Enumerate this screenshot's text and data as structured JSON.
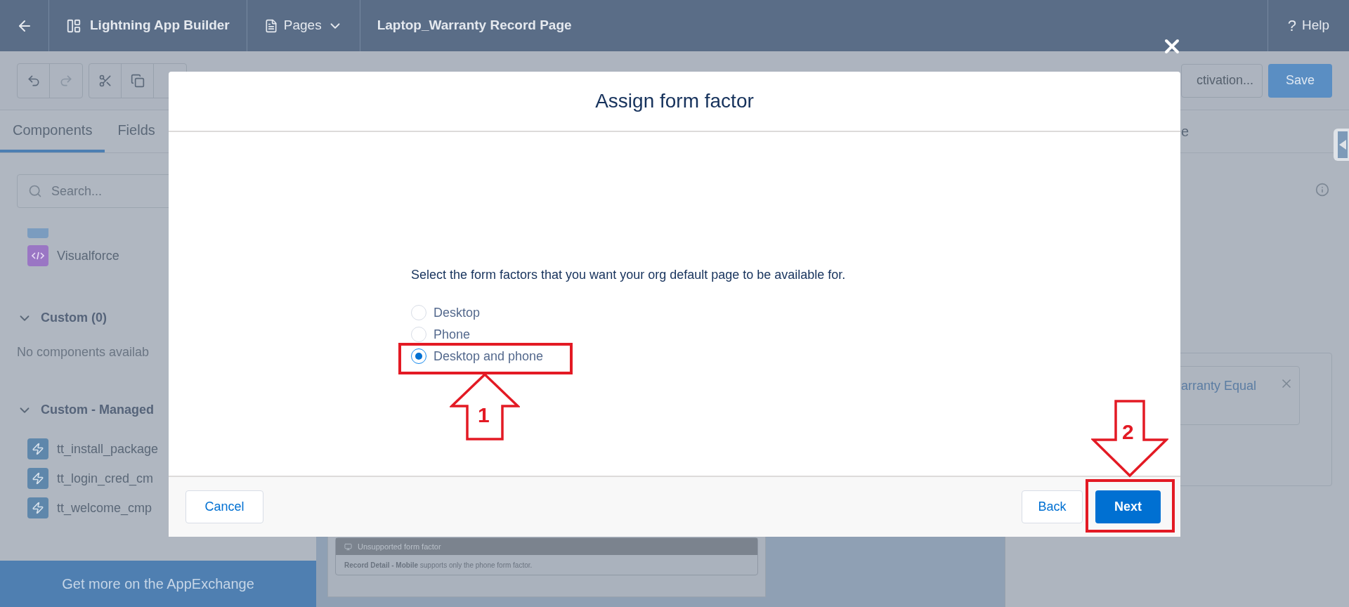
{
  "header": {
    "title": "Lightning App Builder",
    "pages_menu": "Pages",
    "page_name": "Laptop_Warranty Record Page",
    "help_icon": "?",
    "help": "Help"
  },
  "toolbar": {
    "activation_button": "ctivation...",
    "save_button": "Save"
  },
  "left_panel": {
    "tabs": [
      {
        "label": "Components",
        "selected": true
      },
      {
        "label": "Fields",
        "selected": false
      }
    ],
    "search": {
      "placeholder": "Search..."
    },
    "top_items": [
      {
        "kind": "visualforce",
        "label": "Visualforce"
      }
    ],
    "sections": [
      {
        "title": "Custom (0)",
        "expanded": true,
        "empty_text": "No components availab"
      },
      {
        "title": "Custom - Managed",
        "expanded": true,
        "items": [
          {
            "kind": "lightning",
            "label": "tt_install_package"
          },
          {
            "kind": "lightning",
            "label": "tt_login_cred_cm"
          },
          {
            "kind": "lightning",
            "label": "tt_welcome_cmp"
          }
        ]
      }
    ],
    "appexchange": "Get more on the AppExchange"
  },
  "canvas": {
    "warning_title": "Unsupported form factor",
    "warning_text": "**Record Detail - Mobile** supports only the phone form factor."
  },
  "right_panel": {
    "tab_fragment": "e",
    "filter_text": "arranty Equal"
  },
  "modal": {
    "title": "Assign form factor",
    "prompt": "Select the form factors that you want your org default page to be available for.",
    "options": [
      {
        "label": "Desktop",
        "selected": false
      },
      {
        "label": "Phone",
        "selected": false
      },
      {
        "label": "Desktop and phone",
        "selected": true
      }
    ],
    "cancel": "Cancel",
    "back": "Back",
    "next": "Next"
  },
  "annotations": [
    {
      "number": "1",
      "kind": "up-arrow"
    },
    {
      "number": "2",
      "kind": "down-arrow"
    }
  ]
}
